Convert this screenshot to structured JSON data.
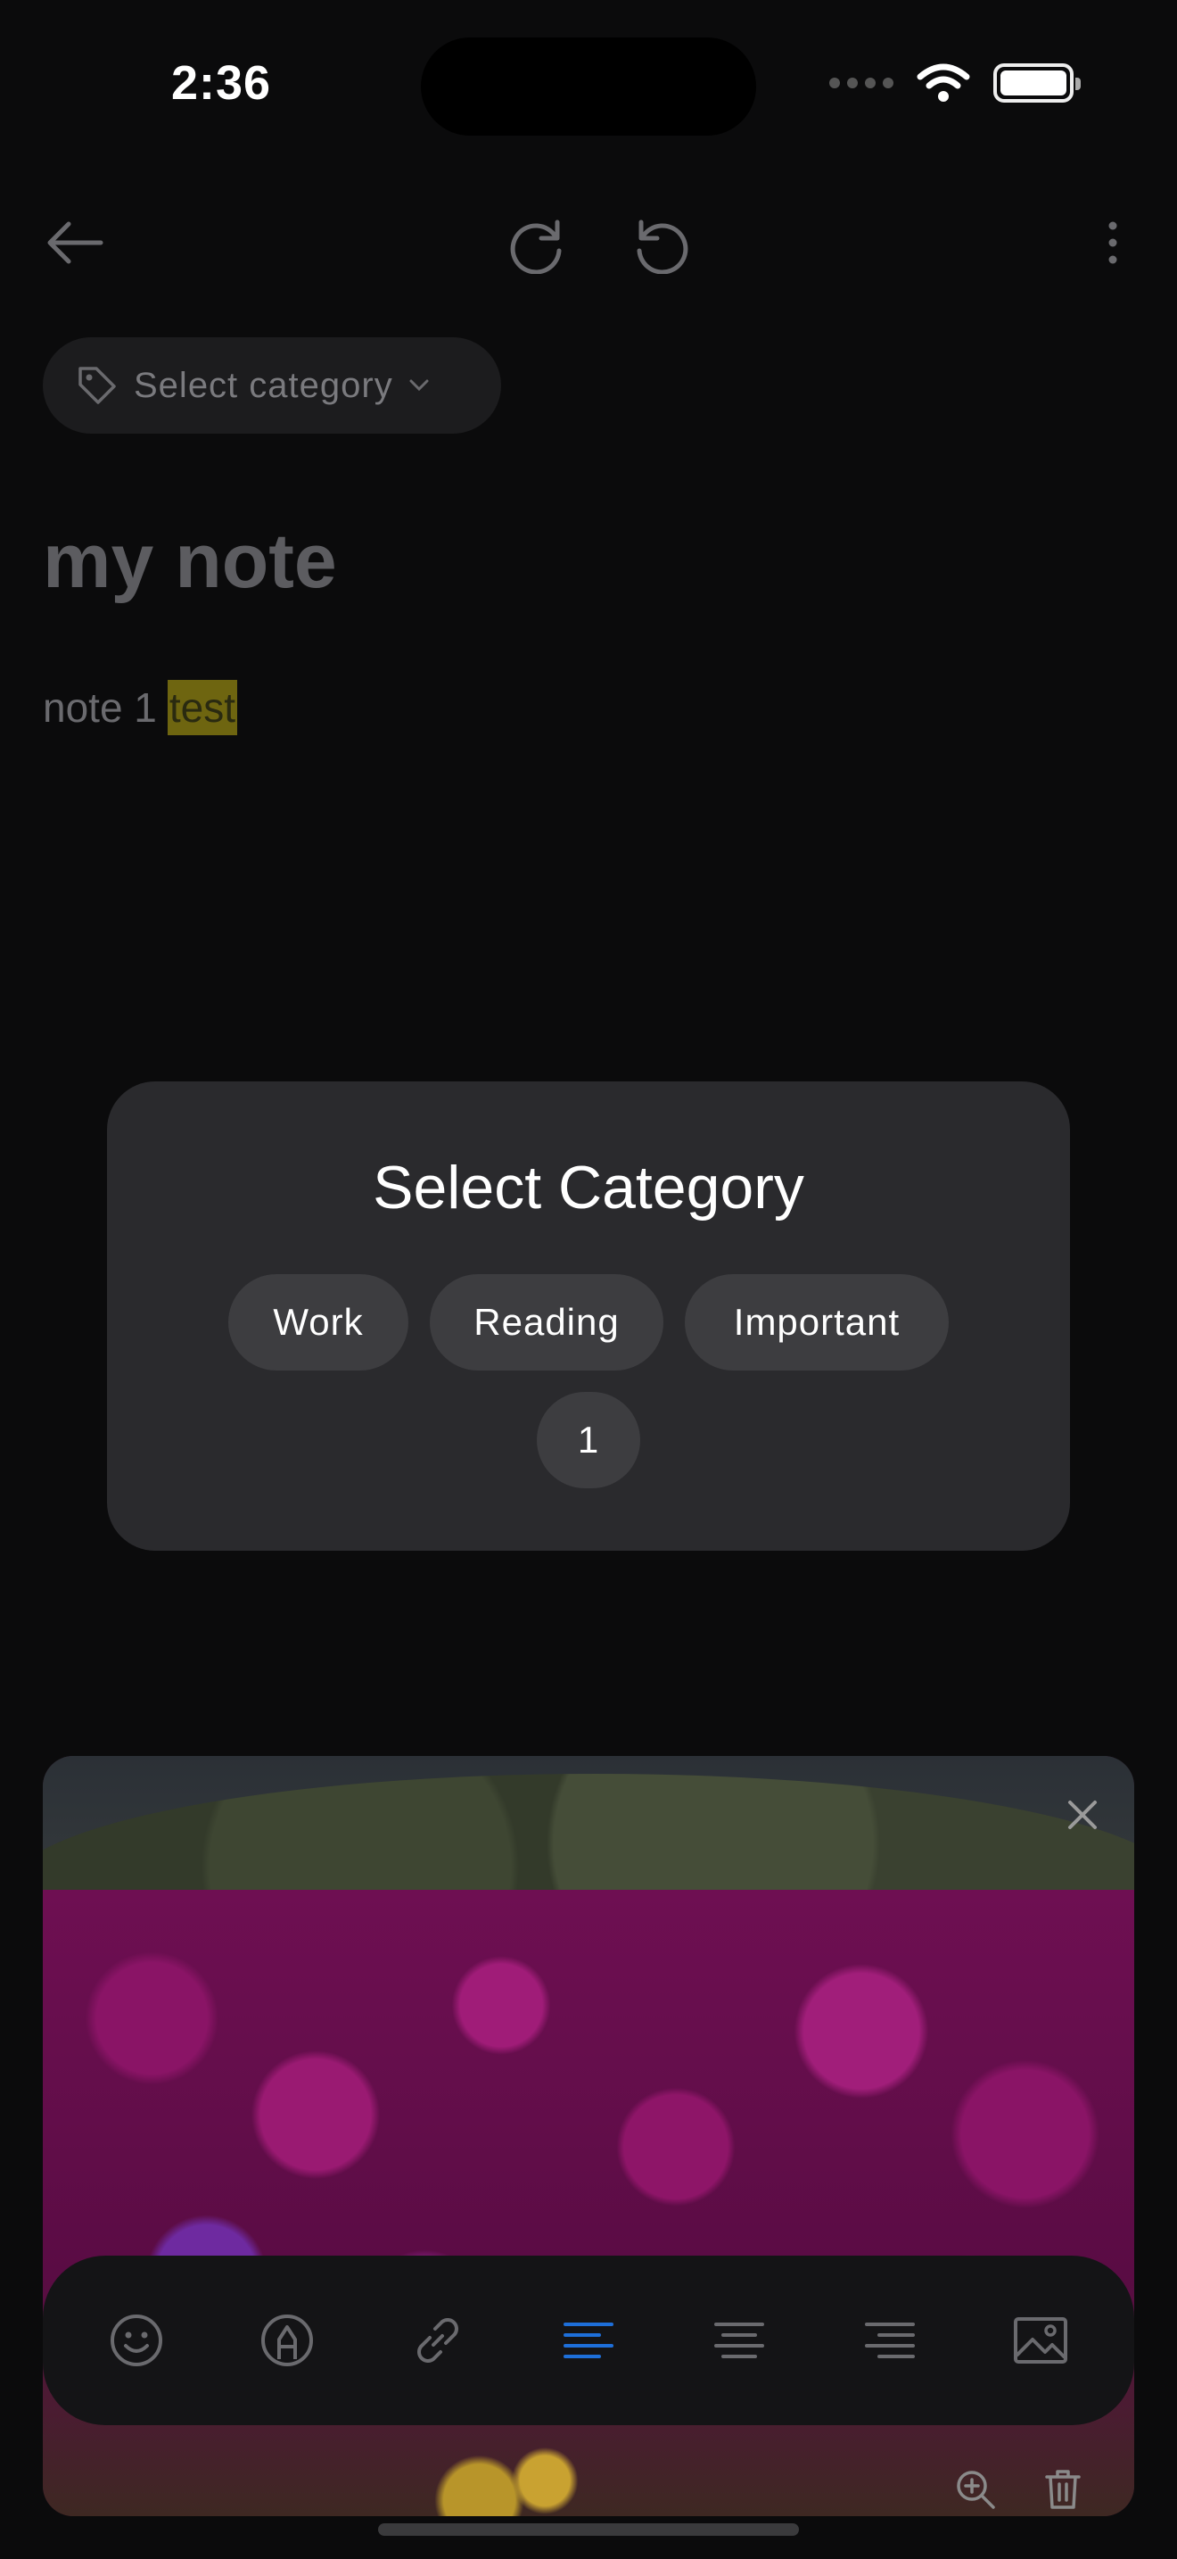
{
  "status_bar": {
    "time": "2:36",
    "icons": [
      "signal-dots",
      "wifi",
      "battery"
    ]
  },
  "top_bar": {
    "icons": [
      "back-arrow",
      "redo",
      "undo",
      "more-vertical"
    ]
  },
  "category": {
    "label": "Select category",
    "icon": "tag"
  },
  "note": {
    "title": "my note",
    "body_plain": "note 1",
    "body_highlighted": "test",
    "highlight_color": "#6e6510"
  },
  "modal": {
    "title": "Select Category",
    "options": [
      "Work",
      "Reading",
      "Important",
      "1"
    ]
  },
  "image": {
    "icons": [
      "close",
      "zoom-in",
      "trash"
    ]
  },
  "toolbar": {
    "icons": [
      "emoji",
      "highlighter",
      "link",
      "align-left",
      "align-center",
      "align-right",
      "image"
    ],
    "active": "align-left",
    "active_color": "#1e6fd9"
  }
}
